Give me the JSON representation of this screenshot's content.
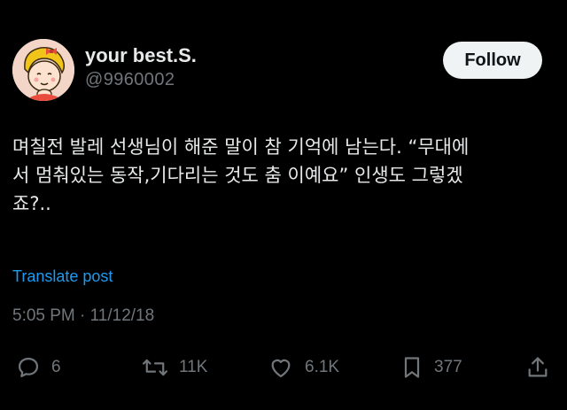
{
  "author": {
    "display_name": "your best.S.",
    "handle": "@9960002"
  },
  "follow_button": {
    "label": "Follow"
  },
  "post": {
    "text": "며칠전 발레 선생님이 해준 말이 참 기억에 남는다. “무대에\n서 멈춰있는 동작,기다리는 것도 춤 이예요” 인생도 그렇겠\n죠?..",
    "translate_label": "Translate post",
    "timestamp": "5:05 PM · 11/12/18"
  },
  "actions": {
    "reply": {
      "icon": "reply-icon",
      "count": "6"
    },
    "repost": {
      "icon": "repost-icon",
      "count": "11K"
    },
    "like": {
      "icon": "heart-icon",
      "count": "6.1K"
    },
    "bookmark": {
      "icon": "bookmark-icon",
      "count": "377"
    },
    "share": {
      "icon": "share-icon"
    }
  },
  "colors": {
    "background": "#000000",
    "primary_text": "#e7e9ea",
    "secondary_text": "#71767b",
    "link": "#1d9bf0",
    "button_bg": "#eff3f4"
  }
}
